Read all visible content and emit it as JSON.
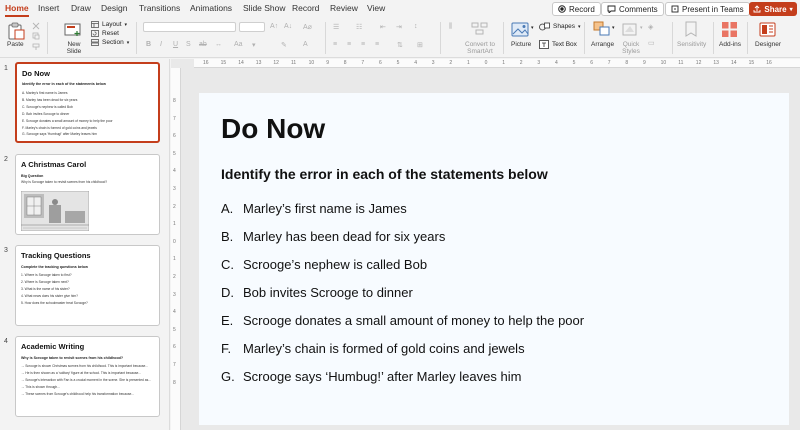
{
  "tabs": [
    "Home",
    "Insert",
    "Draw",
    "Design",
    "Transitions",
    "Animations",
    "Slide Show",
    "Record",
    "Review",
    "View"
  ],
  "titlebar": {
    "record_label": "Record",
    "comments_label": "Comments",
    "present_label": "Present in Teams",
    "share_label": "Share"
  },
  "ribbon": {
    "paste": "Paste",
    "new_slide": "New Slide",
    "layout": "Layout",
    "reset": "Reset",
    "section": "Section",
    "convert_smartart": "Convert to SmartArt",
    "picture": "Picture",
    "shapes": "Shapes",
    "text_box": "Text Box",
    "arrange": "Arrange",
    "quick_styles": "Quick Styles",
    "sensitivity": "Sensitivity",
    "add_ins": "Add-ins",
    "designer": "Designer"
  },
  "thumbnails": [
    {
      "number": "1",
      "title": "Do Now",
      "subtitle": "Identify the error in each of the statements below",
      "lines": [
        "A.   Marley's first name is James",
        "B.   Marley has been dead for six years",
        "C.   Scrooge's nephew is called Bob",
        "D.   Bob invites Scrooge to dinner",
        "E.   Scrooge donates a small amount of money to help the poor",
        "F.   Marley's chain is formed of gold coins and jewels",
        "G.   Scrooge says 'Humbug!' after Marley leaves him"
      ]
    },
    {
      "number": "2",
      "title": "A Christmas Carol",
      "subtitle": "Big Question",
      "lines": [
        "Why is Scrooge taken to revisit scenes from his childhood?"
      ]
    },
    {
      "number": "3",
      "title": "Tracking Questions",
      "subtitle": "Complete the tracking questions below",
      "lines": [
        "1.   Where is Scrooge taken to first?",
        "2.   Where is Scrooge taken next?",
        "3.   What is the name of his sister?",
        "4.   What news does his sister give him?",
        "5.   How does the schoolmaster treat Scrooge?"
      ]
    },
    {
      "number": "4",
      "title": "Academic Writing",
      "subtitle": "Why is Scrooge taken to revisit scenes from his childhood?",
      "lines": [
        "→   Scrooge is shown Christmas scenes from his childhood. This is important because...",
        "→   He is then shown as a 'solitary' figure at the school. This is important because...",
        "→   Scrooge's interaction with Fan is a crucial moment in the scene. She is presented as...",
        "→   This is shown through...",
        "→   These scenes from Scrooge's childhood help his transformation because..."
      ]
    }
  ],
  "ruler": {
    "h_ticks": [
      "16",
      "15",
      "14",
      "13",
      "12",
      "11",
      "10",
      "9",
      "8",
      "7",
      "6",
      "5",
      "4",
      "3",
      "2",
      "1",
      "0",
      "1",
      "2",
      "3",
      "4",
      "5",
      "6",
      "7",
      "8",
      "9",
      "10",
      "11",
      "12",
      "13",
      "14",
      "15",
      "16"
    ],
    "v_ticks": [
      "8",
      "7",
      "6",
      "5",
      "4",
      "3",
      "2",
      "1",
      "0",
      "1",
      "2",
      "3",
      "4",
      "5",
      "6",
      "7",
      "8"
    ]
  },
  "slide": {
    "title": "Do Now",
    "subtitle": "Identify the error in each of the statements below",
    "items": [
      {
        "marker": "A.",
        "text": "Marley’s first name is James"
      },
      {
        "marker": "B.",
        "text": "Marley has been dead for six years"
      },
      {
        "marker": "C.",
        "text": "Scrooge’s nephew is called Bob"
      },
      {
        "marker": "D.",
        "text": "Bob invites Scrooge to dinner"
      },
      {
        "marker": "E.",
        "text": "Scrooge donates a small amount of money to help the poor"
      },
      {
        "marker": "F.",
        "text": "Marley’s chain is formed of gold coins and jewels"
      },
      {
        "marker": "G.",
        "text": "Scrooge says ‘Humbug!’ after Marley leaves him"
      }
    ]
  },
  "colors": {
    "accent": "#c43e1c",
    "slide_bg": "#f7fbff"
  }
}
